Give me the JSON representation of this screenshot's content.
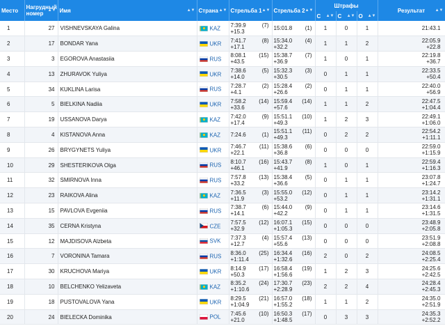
{
  "headers": {
    "place": "Место",
    "bib": "Нагрудный номер",
    "name": "Имя",
    "country": "Страна",
    "shoot1": "Стрельба 1",
    "shoot2": "Стрельба 2",
    "penalties": "Штрафы",
    "pen_c1": "С",
    "pen_c2": "С",
    "pen_o": "О",
    "result": "Результат"
  },
  "sort_glyph": "▲▼",
  "flags": {
    "KAZ": {
      "kind": "kaz",
      "colors": [
        "#00afca",
        "#fec50c"
      ]
    },
    "UKR": {
      "kind": "h2",
      "colors": [
        "#0057b7",
        "#ffd700"
      ]
    },
    "RUS": {
      "kind": "h3",
      "colors": [
        "#ffffff",
        "#0039a6",
        "#d52b1e"
      ]
    },
    "CZE": {
      "kind": "cze",
      "colors": [
        "#ffffff",
        "#d7141a",
        "#11457e"
      ]
    },
    "SVK": {
      "kind": "h3",
      "colors": [
        "#ffffff",
        "#0b4ea2",
        "#ee1c25"
      ]
    },
    "POL": {
      "kind": "h2",
      "colors": [
        "#ffffff",
        "#dc143c"
      ]
    }
  },
  "rows": [
    {
      "place": "1",
      "bib": "27",
      "name": "VISHNEVSKAYA Galina",
      "country": "KAZ",
      "s1_time": "7:39.9",
      "s1_diff": "+15.3",
      "s1_rank": "(7)",
      "s2_time": "15:01.8",
      "s2_diff": "",
      "s2_rank": "(1)",
      "p1": "1",
      "p2": "0",
      "p3": "1",
      "result": "21:43.1",
      "result_diff": ""
    },
    {
      "place": "2",
      "bib": "17",
      "name": "BONDAR Yana",
      "country": "UKR",
      "s1_time": "7:41.7",
      "s1_diff": "+17.1",
      "s1_rank": "(8)",
      "s2_time": "15:34.0",
      "s2_diff": "+32.2",
      "s2_rank": "(4)",
      "p1": "1",
      "p2": "1",
      "p3": "2",
      "result": "22:05.9",
      "result_diff": "+22.8"
    },
    {
      "place": "3",
      "bib": "3",
      "name": "EGOROVA Anastasiia",
      "country": "RUS",
      "s1_time": "8:08.1",
      "s1_diff": "+43.5",
      "s1_rank": "(15)",
      "s2_time": "15:38.7",
      "s2_diff": "+36.9",
      "s2_rank": "(7)",
      "p1": "1",
      "p2": "0",
      "p3": "1",
      "result": "22:19.8",
      "result_diff": "+36.7"
    },
    {
      "place": "4",
      "bib": "13",
      "name": "ZHURAVOK Yuliya",
      "country": "UKR",
      "s1_time": "7:38.6",
      "s1_diff": "+14.0",
      "s1_rank": "(5)",
      "s2_time": "15:32.3",
      "s2_diff": "+30.5",
      "s2_rank": "(3)",
      "p1": "0",
      "p2": "1",
      "p3": "1",
      "result": "22:33.5",
      "result_diff": "+50.4"
    },
    {
      "place": "5",
      "bib": "34",
      "name": "KUKLINA Larisa",
      "country": "RUS",
      "s1_time": "7:28.7",
      "s1_diff": "+4.1",
      "s1_rank": "(2)",
      "s2_time": "15:28.4",
      "s2_diff": "+26.6",
      "s2_rank": "(2)",
      "p1": "0",
      "p2": "1",
      "p3": "1",
      "result": "22:40.0",
      "result_diff": "+56.9"
    },
    {
      "place": "6",
      "bib": "5",
      "name": "BIELKINA Nadiia",
      "country": "UKR",
      "s1_time": "7:58.2",
      "s1_diff": "+33.6",
      "s1_rank": "(14)",
      "s2_time": "15:59.4",
      "s2_diff": "+57.6",
      "s2_rank": "(14)",
      "p1": "1",
      "p2": "1",
      "p3": "2",
      "result": "22:47.5",
      "result_diff": "+1:04.4"
    },
    {
      "place": "7",
      "bib": "19",
      "name": "USSANOVA Darya",
      "country": "KAZ",
      "s1_time": "7:42.0",
      "s1_diff": "+17.4",
      "s1_rank": "(9)",
      "s2_time": "15:51.1",
      "s2_diff": "+49.3",
      "s2_rank": "(10)",
      "p1": "1",
      "p2": "2",
      "p3": "3",
      "result": "22:49.1",
      "result_diff": "+1:06.0"
    },
    {
      "place": "8",
      "bib": "4",
      "name": "KISTANOVA Anna",
      "country": "KAZ",
      "s1_time": "7:24.6",
      "s1_diff": "",
      "s1_rank": "(1)",
      "s2_time": "15:51.1",
      "s2_diff": "+49.3",
      "s2_rank": "(11)",
      "p1": "0",
      "p2": "2",
      "p3": "2",
      "result": "22:54.2",
      "result_diff": "+1:11.1"
    },
    {
      "place": "9",
      "bib": "26",
      "name": "BRYGYNETS Yuliya",
      "country": "UKR",
      "s1_time": "7:46.7",
      "s1_diff": "+22.1",
      "s1_rank": "(11)",
      "s2_time": "15:38.6",
      "s2_diff": "+36.8",
      "s2_rank": "(6)",
      "p1": "0",
      "p2": "0",
      "p3": "0",
      "result": "22:59.0",
      "result_diff": "+1:15.9"
    },
    {
      "place": "10",
      "bib": "29",
      "name": "SHESTERIKOVA Olga",
      "country": "RUS",
      "s1_time": "8:10.7",
      "s1_diff": "+46.1",
      "s1_rank": "(16)",
      "s2_time": "15:43.7",
      "s2_diff": "+41.9",
      "s2_rank": "(8)",
      "p1": "1",
      "p2": "0",
      "p3": "1",
      "result": "22:59.4",
      "result_diff": "+1:16.3"
    },
    {
      "place": "11",
      "bib": "32",
      "name": "SMIRNOVA Inna",
      "country": "RUS",
      "s1_time": "7:57.8",
      "s1_diff": "+33.2",
      "s1_rank": "(13)",
      "s2_time": "15:38.4",
      "s2_diff": "+36.6",
      "s2_rank": "(5)",
      "p1": "0",
      "p2": "1",
      "p3": "1",
      "result": "23:07.8",
      "result_diff": "+1:24.7"
    },
    {
      "place": "12",
      "bib": "23",
      "name": "RAIKOVA Alina",
      "country": "KAZ",
      "s1_time": "7:36.5",
      "s1_diff": "+11.9",
      "s1_rank": "(3)",
      "s2_time": "15:55.0",
      "s2_diff": "+53.2",
      "s2_rank": "(12)",
      "p1": "0",
      "p2": "1",
      "p3": "1",
      "result": "23:14.2",
      "result_diff": "+1:31.1"
    },
    {
      "place": "13",
      "bib": "15",
      "name": "PAVLOVA Evgeniia",
      "country": "RUS",
      "s1_time": "7:38.7",
      "s1_diff": "+14.1",
      "s1_rank": "(6)",
      "s2_time": "15:44.0",
      "s2_diff": "+42.2",
      "s2_rank": "(9)",
      "p1": "0",
      "p2": "1",
      "p3": "1",
      "result": "23:14.6",
      "result_diff": "+1:31.5"
    },
    {
      "place": "14",
      "bib": "35",
      "name": "CERNA Kristyna",
      "country": "CZE",
      "s1_time": "7:57.5",
      "s1_diff": "+32.9",
      "s1_rank": "(12)",
      "s2_time": "16:07.1",
      "s2_diff": "+1:05.3",
      "s2_rank": "(15)",
      "p1": "0",
      "p2": "0",
      "p3": "0",
      "result": "23:48.9",
      "result_diff": "+2:05.8"
    },
    {
      "place": "15",
      "bib": "12",
      "name": "MAJDISOVA Alzbeta",
      "country": "SVK",
      "s1_time": "7:37.3",
      "s1_diff": "+12.7",
      "s1_rank": "(4)",
      "s2_time": "15:57.4",
      "s2_diff": "+55.6",
      "s2_rank": "(13)",
      "p1": "0",
      "p2": "0",
      "p3": "0",
      "result": "23:51.9",
      "result_diff": "+2:08.8"
    },
    {
      "place": "16",
      "bib": "7",
      "name": "VORONINA Tamara",
      "country": "RUS",
      "s1_time": "8:36.0",
      "s1_diff": "+1:11.4",
      "s1_rank": "(25)",
      "s2_time": "16:34.4",
      "s2_diff": "+1:32.6",
      "s2_rank": "(16)",
      "p1": "2",
      "p2": "0",
      "p3": "2",
      "result": "24:08.5",
      "result_diff": "+2:25.4"
    },
    {
      "place": "17",
      "bib": "30",
      "name": "KRUCHOVA Mariya",
      "country": "UKR",
      "s1_time": "8:14.9",
      "s1_diff": "+50.3",
      "s1_rank": "(17)",
      "s2_time": "16:58.4",
      "s2_diff": "+1:56.6",
      "s2_rank": "(19)",
      "p1": "1",
      "p2": "2",
      "p3": "3",
      "result": "24:25.6",
      "result_diff": "+2:42.5"
    },
    {
      "place": "18",
      "bib": "10",
      "name": "BELCHENKO Yelizaveta",
      "country": "KAZ",
      "s1_time": "8:35.2",
      "s1_diff": "+1:10.6",
      "s1_rank": "(24)",
      "s2_time": "17:30.7",
      "s2_diff": "+2:28.9",
      "s2_rank": "(23)",
      "p1": "2",
      "p2": "2",
      "p3": "4",
      "result": "24:28.4",
      "result_diff": "+2:45.3"
    },
    {
      "place": "19",
      "bib": "18",
      "name": "PUSTOVALOVA Yana",
      "country": "UKR",
      "s1_time": "8:29.5",
      "s1_diff": "+1:04.9",
      "s1_rank": "(21)",
      "s2_time": "16:57.0",
      "s2_diff": "+1:55.2",
      "s2_rank": "(18)",
      "p1": "1",
      "p2": "1",
      "p3": "2",
      "result": "24:35.0",
      "result_diff": "+2:51.9"
    },
    {
      "place": "20",
      "bib": "24",
      "name": "BIELECKA Dominika",
      "country": "POL",
      "s1_time": "7:45.6",
      "s1_diff": "+21.0",
      "s1_rank": "(10)",
      "s2_time": "16:50.3",
      "s2_diff": "+1:48.5",
      "s2_rank": "(17)",
      "p1": "0",
      "p2": "3",
      "p3": "3",
      "result": "24:35.3",
      "result_diff": "+2:52.2"
    }
  ]
}
